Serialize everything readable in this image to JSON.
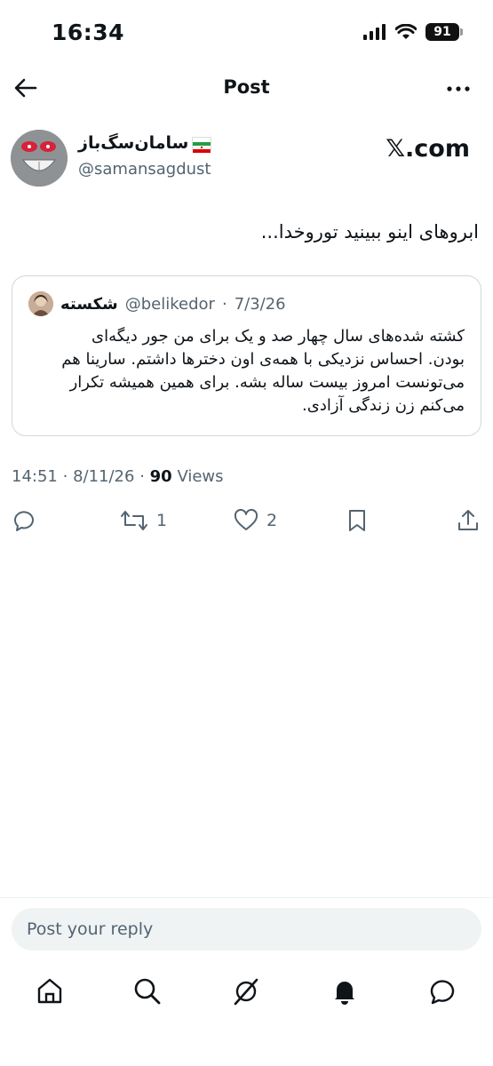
{
  "status_bar": {
    "time": "16:34",
    "battery": "91"
  },
  "header": {
    "title": "Post"
  },
  "author": {
    "name": "سامان‌سگ‌باز",
    "handle": "@samansagdust"
  },
  "source": {
    "logo": "𝕏.com"
  },
  "tweet": {
    "text": "ابروهای اینو ببینید توروخدا..."
  },
  "quote": {
    "name": "شکسته",
    "handle": "@belikedor",
    "date": "7/3/26",
    "lines": [
      "کشته شده‌های سال چهار صد و یک برای من جور دیگه‌ای",
      "بودن. احساس نزدیکی با همه‌ی اون دخترها داشتم. سارینا هم",
      "می‌تونست امروز بیست ساله بشه. برای همین همیشه تکرار",
      "می‌کنم زن زندگی آزادی."
    ]
  },
  "meta": {
    "time": "14:51",
    "date": "8/11/26",
    "views_count": "90",
    "views_label": "Views"
  },
  "actions": {
    "retweets": "1",
    "likes": "2"
  },
  "reply": {
    "placeholder": "Post your reply"
  },
  "icons": {
    "back": "arrow-left-icon",
    "more": "more-horizontal-icon",
    "reply": "comment-icon",
    "retweet": "retweet-icon",
    "like": "heart-icon",
    "bookmark": "bookmark-icon",
    "share": "share-icon",
    "nav": [
      "home-icon",
      "search-icon",
      "grok-icon",
      "bell-icon",
      "messages-icon"
    ]
  },
  "colors": {
    "text": "#0f1419",
    "secondary": "#536471",
    "border": "#cfd9de",
    "reply_bg": "#eff3f4"
  }
}
